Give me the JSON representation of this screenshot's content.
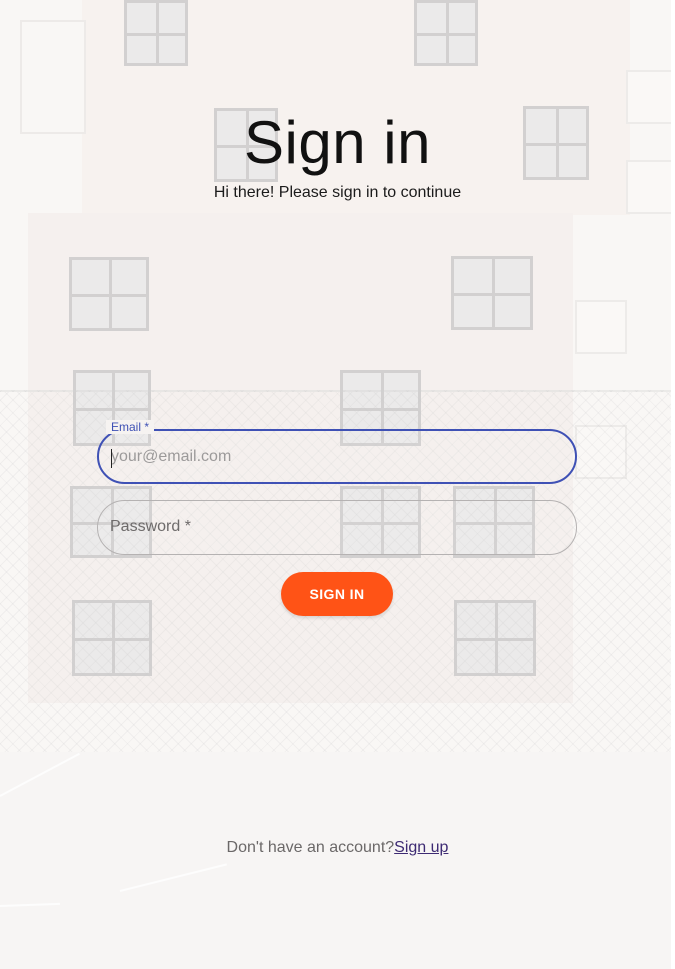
{
  "header": {
    "title": "Sign in",
    "subtitle": "Hi there! Please sign in to continue"
  },
  "form": {
    "email": {
      "label": "Email *",
      "placeholder": "your@email.com",
      "value": ""
    },
    "password": {
      "label": "Password *",
      "value": ""
    },
    "submit_label": "SIGN IN"
  },
  "footer": {
    "prompt": "Don't have an account?",
    "link_label": "Sign up"
  },
  "colors": {
    "accent": "#3f51b5",
    "button": "#ff5316",
    "link": "#3d2a73"
  }
}
